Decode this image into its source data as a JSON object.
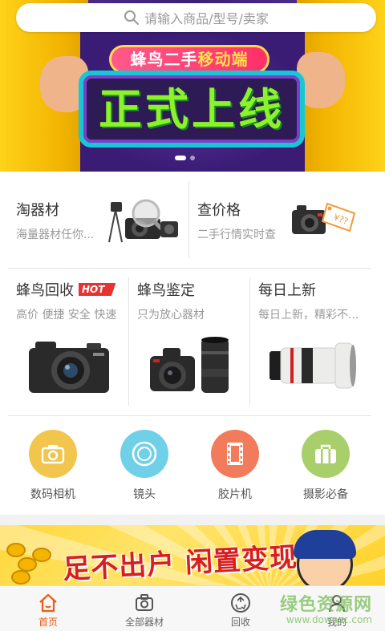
{
  "search": {
    "placeholder": "请输入商品/型号/卖家"
  },
  "banner": {
    "pill_left": "蜂鸟二手",
    "pill_right": "移动端",
    "headline": "正式上线",
    "slide_count": 2,
    "active_slide": 1
  },
  "quick": [
    {
      "title": "淘器材",
      "subtitle": "海量器材任你...",
      "icon": "camera-gear-icon"
    },
    {
      "title": "查价格",
      "subtitle": "二手行情实时查",
      "icon": "price-tag-camera-icon"
    }
  ],
  "featured": [
    {
      "title": "蜂鸟回收",
      "badge": "HOT",
      "subtitle": "高价 便捷 安全 快速",
      "icon": "compact-camera-icon"
    },
    {
      "title": "蜂鸟鉴定",
      "subtitle": "只为放心器材",
      "icon": "dslr-with-lens-icon"
    },
    {
      "title": "每日上新",
      "subtitle": "每日上新，精彩不...",
      "icon": "telephoto-lens-icon"
    }
  ],
  "categories": [
    {
      "label": "数码相机",
      "icon": "camera-icon",
      "color": "#f2c64d"
    },
    {
      "label": "镜头",
      "icon": "lens-icon",
      "color": "#6fd0e8"
    },
    {
      "label": "胶片机",
      "icon": "film-icon",
      "color": "#f27b5b"
    },
    {
      "label": "摄影必备",
      "icon": "bag-icon",
      "color": "#a8cf6a"
    }
  ],
  "promo": {
    "slogan": "足不出户 闲置变现"
  },
  "nav": [
    {
      "label": "首页",
      "icon": "home-icon",
      "active": true
    },
    {
      "label": "全部器材",
      "icon": "equipment-icon",
      "active": false
    },
    {
      "label": "回收",
      "icon": "recycle-icon",
      "active": false
    },
    {
      "label": "我的",
      "icon": "user-icon",
      "active": false
    }
  ],
  "watermark": {
    "main": "绿色资源网",
    "sub": "www.downcc.com"
  },
  "colors": {
    "accent": "#f05a14",
    "hot": "#e8322f",
    "banner_text": "#8cf22a"
  }
}
